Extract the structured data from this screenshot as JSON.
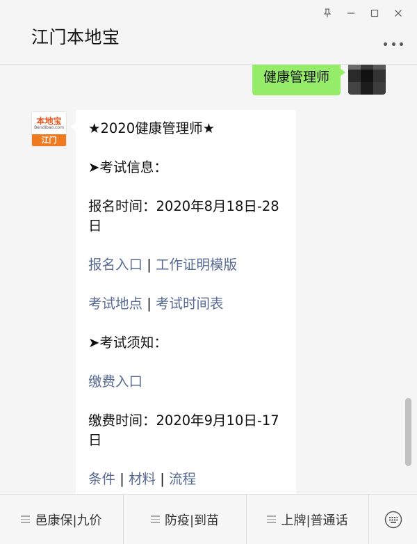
{
  "header": {
    "title": "江门本地宝"
  },
  "window_controls": {
    "pin_icon": "pin-icon",
    "minimize_icon": "minimize-icon",
    "maximize_icon": "maximize-icon",
    "close_icon": "close-icon"
  },
  "chat": {
    "sent_message": "健康管理师",
    "received": {
      "avatar": {
        "logo_main": "本地宝",
        "logo_sub": "Bendibao.com",
        "logo_city": "江门"
      },
      "lines": {
        "title": "★2020健康管理师★",
        "exam_info_heading": "➤考试信息：",
        "register_time": "报名时间：2020年8月18日-28日",
        "register_entry_link": "报名入口",
        "work_cert_link": "工作证明模版",
        "exam_location_link": "考试地点",
        "exam_schedule_link": "考试时间表",
        "exam_notice_heading": "➤考试须知：",
        "payment_entry_link": "缴费入口",
        "payment_time": "缴费时间：2020年9月10日-17日",
        "conditions_link": "条件",
        "materials_link": "材料",
        "process_link": "流程",
        "separator": "|"
      }
    }
  },
  "bottom_menu": {
    "items": [
      {
        "label": "邑康保|九价"
      },
      {
        "label": "防疫|到苗"
      },
      {
        "label": "上牌|普通话"
      }
    ],
    "keyboard_icon": "keyboard-icon"
  },
  "colors": {
    "link": "#576b95",
    "sent_bubble": "#95ec69",
    "background": "#f5f5f5"
  }
}
